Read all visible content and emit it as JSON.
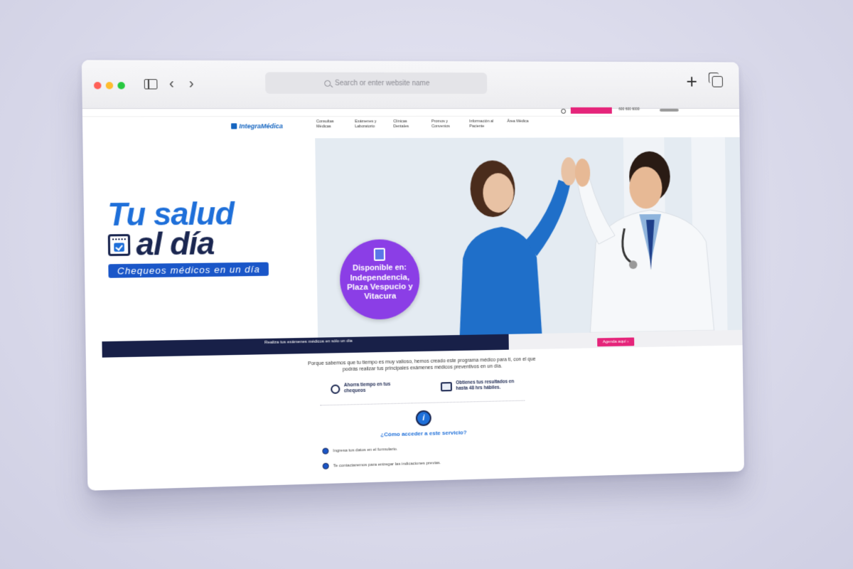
{
  "browser": {
    "address_placeholder": "Search or enter website name"
  },
  "util": {
    "phone": "600 600 6000"
  },
  "site": {
    "logo": "IntegraMédica",
    "nav": [
      "Consultas Médicas",
      "Exámenes y Laboratorio",
      "Clínicas Dentales",
      "Promos y Convenios",
      "Información al Paciente",
      "Área Médica"
    ]
  },
  "hero": {
    "title": "Tu salud",
    "subtitle": "al día",
    "pill": "Chequeos médicos en un día",
    "badge_heading": "Disponible en:",
    "badge_locations": "Independencia, Plaza Vespucio y Vitacura"
  },
  "band": {
    "text": "Realiza tus exámenes médicos en sólo un día",
    "button": "Agenda aquí"
  },
  "intro": "Porque sabemos que tu tiempo es muy valioso, hemos creado este programa médico para ti, con el que podrás realizar tus principales exámenes médicos preventivos en un día.",
  "features": [
    "Ahorra tiempo en tus chequeos",
    "Obtienes tus resultados en hasta 48 hrs hábiles."
  ],
  "how": {
    "icon_letter": "i",
    "question": "¿Cómo acceder a este servicio?",
    "steps": [
      "Ingresa tus datos en el formulario.",
      "Te contactaremos para entregar las indicaciones previas."
    ]
  },
  "colors": {
    "background": "#d9d9ea",
    "brand_blue": "#1e6fd9",
    "navy": "#182048",
    "pink": "#e5247a",
    "purple": "#8b3ee6"
  }
}
